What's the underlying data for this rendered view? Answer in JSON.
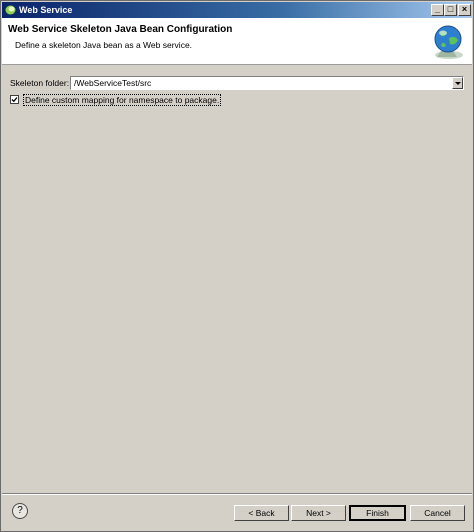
{
  "window": {
    "title": "Web Service",
    "min_glyph": "_",
    "max_glyph": "□",
    "close_glyph": "×"
  },
  "banner": {
    "title": "Web Service Skeleton Java Bean Configuration",
    "description": "Define a skeleton Java bean as a Web service.",
    "icon": "globe-wizard-icon"
  },
  "form": {
    "skeleton_folder_label": "Skeleton folder:",
    "skeleton_folder_value": "/WebServiceTest/src",
    "custom_mapping_label": "Define custom mapping for namespace to package.",
    "custom_mapping_checked": true
  },
  "footer": {
    "help_glyph": "?",
    "back_label": "< Back",
    "next_label": "Next >",
    "finish_label": "Finish",
    "cancel_label": "Cancel"
  },
  "colors": {
    "window_bg": "#d4d0c8",
    "title_bar": "#0a246a",
    "banner_bg": "#ffffff"
  }
}
